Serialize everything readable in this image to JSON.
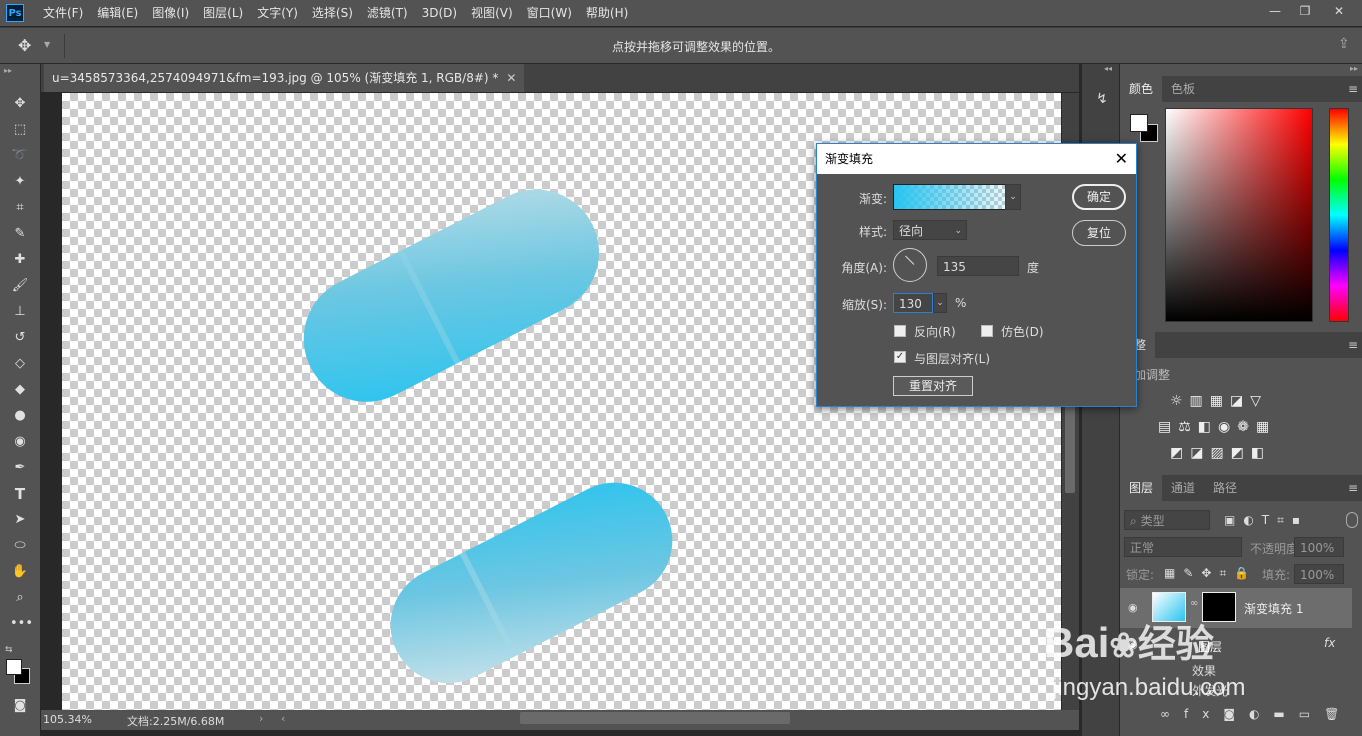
{
  "app": {
    "logo": "Ps"
  },
  "menu": [
    "文件(F)",
    "编辑(E)",
    "图像(I)",
    "图层(L)",
    "文字(Y)",
    "选择(S)",
    "滤镜(T)",
    "3D(D)",
    "视图(V)",
    "窗口(W)",
    "帮助(H)"
  ],
  "options_bar": {
    "hint": "点按并拖移可调整效果的位置。"
  },
  "document": {
    "tab_title": "u=3458573364,2574094971&fm=193.jpg @ 105% (渐变填充 1, RGB/8#) *",
    "close": "✕"
  },
  "status": {
    "zoom": "105.34%",
    "doc_info": "文档:2.25M/6.68M"
  },
  "dialog": {
    "title": "渐变填充",
    "gradient_label": "渐变:",
    "style_label": "样式:",
    "style_value": "径向",
    "angle_label": "角度(A):",
    "angle_value": "135",
    "angle_unit": "度",
    "scale_label": "缩放(S):",
    "scale_value": "130",
    "scale_unit": "%",
    "reverse_label": "反向(R)",
    "dither_label": "仿色(D)",
    "align_label": "与图层对齐(L)",
    "align_checked": true,
    "reset_align": "重置对齐",
    "ok": "确定",
    "reset": "复位",
    "gradient_color": "#27c4f0"
  },
  "color_panel": {
    "tabs": [
      "颜色",
      "色板"
    ]
  },
  "adjust_panel": {
    "tab": "调整",
    "add_label": "添加调整"
  },
  "layers_panel": {
    "tabs": [
      "图层",
      "通道",
      "路径"
    ],
    "filter_label": "类型",
    "blend_mode": "正常",
    "opacity_label": "不透明度:",
    "opacity_value": "100%",
    "lock_label": "锁定:",
    "fill_label": "填充:",
    "fill_value": "100%",
    "layers": [
      {
        "name": "渐变填充 1"
      },
      {
        "name": "图层"
      }
    ],
    "effects_label": "效果",
    "effect_item": "外发光",
    "fx": "fx"
  },
  "watermark": {
    "brand": "Bai",
    "brand_cn": "经验",
    "url": "jingyan.baidu.com"
  }
}
